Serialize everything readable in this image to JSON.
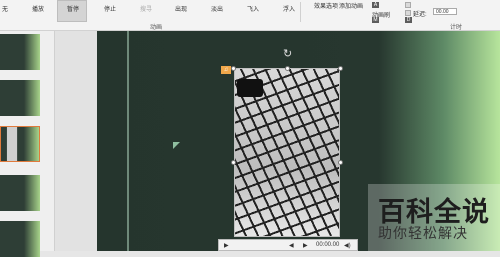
{
  "ribbon": {
    "btn_none": "无",
    "btn_play": "播放",
    "btn_pause": "暂停",
    "btn_stop": "停止",
    "btn_seek": "搜寻",
    "btn_appear": "出现",
    "btn_exit": "淡出",
    "btn_fly": "飞入",
    "btn_float": "浮入",
    "effect_options": "效果选项",
    "add_animation": "添加动画",
    "animation_painter": "动画刷",
    "trigger": "触发",
    "duration_label": "持续:",
    "delay_label": "延迟:",
    "delay_value": "00.00",
    "group_animation": "动画",
    "group_timing": "计时",
    "tiny_A": "A",
    "tiny_D": "D",
    "tiny_M": "M"
  },
  "thumbs": {
    "current_index": 3
  },
  "video": {
    "tag": "♫"
  },
  "controls": {
    "play": "▶",
    "back": "◀",
    "forward": "▶",
    "time": "00:00.00",
    "volume": "◀)"
  },
  "watermark": {
    "line1": "百科全说",
    "line2": "助你轻松解决"
  }
}
